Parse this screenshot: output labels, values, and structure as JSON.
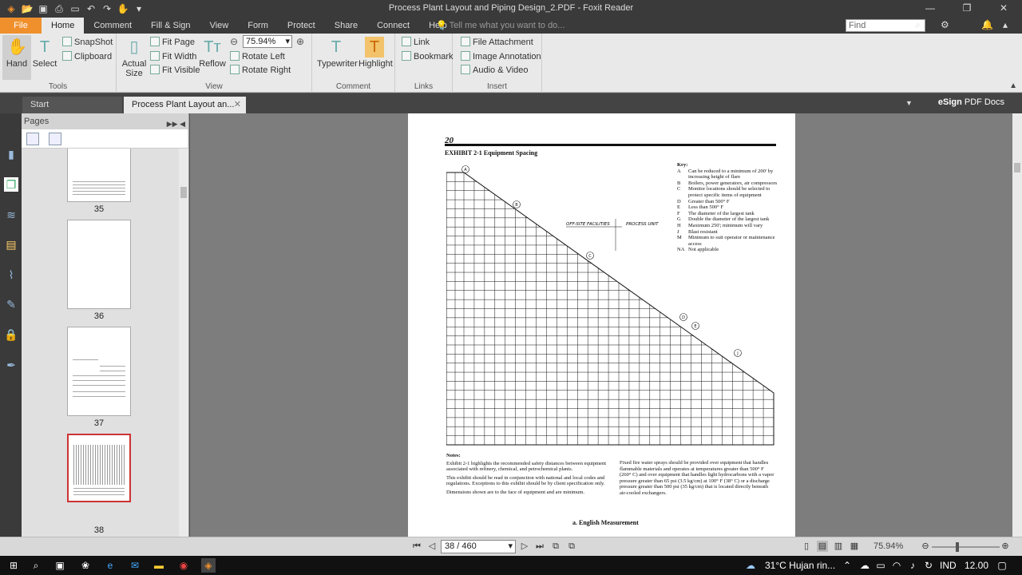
{
  "window": {
    "title": "Process Plant Layout and Piping Design_2.PDF - Foxit Reader",
    "controls": [
      "—",
      "❐",
      "✕"
    ]
  },
  "menu": {
    "file": "File",
    "tabs": [
      "Home",
      "Comment",
      "Fill & Sign",
      "View",
      "Form",
      "Protect",
      "Share",
      "Connect",
      "Help"
    ],
    "active_tab": "Home",
    "tell_me_placeholder": "Tell me what you want to do...",
    "find_placeholder": "Find"
  },
  "ribbon": {
    "tools": {
      "label": "Tools",
      "hand": "Hand",
      "select": "Select",
      "snapshot": "SnapShot",
      "clipboard": "Clipboard"
    },
    "view": {
      "label": "View",
      "actual_size": "Actual Size",
      "fit_page": "Fit Page",
      "fit_width": "Fit Width",
      "fit_visible": "Fit Visible",
      "reflow": "Reflow",
      "zoom_value": "75.94%",
      "rotate_left": "Rotate Left",
      "rotate_right": "Rotate Right"
    },
    "comment": {
      "label": "Comment",
      "typewriter": "Typewriter",
      "highlight": "Highlight"
    },
    "links": {
      "label": "Links",
      "link": "Link",
      "bookmark": "Bookmark"
    },
    "insert": {
      "label": "Insert",
      "file_attachment": "File Attachment",
      "image_annotation": "Image Annotation",
      "audio_video": "Audio & Video"
    }
  },
  "doc_tabs": {
    "start": "Start",
    "current": "Process Plant Layout an..."
  },
  "esign": {
    "bold": "eSign",
    "rest": " PDF Docs"
  },
  "pages_panel": {
    "title": "Pages",
    "thumbnails": [
      {
        "number": "35"
      },
      {
        "number": "36"
      },
      {
        "number": "37"
      },
      {
        "number": "38"
      }
    ]
  },
  "document": {
    "page_number": "20",
    "exhibit": "EXHIBIT 2-1    Equipment Spacing",
    "handwritten_1": "OFF-SITE FACILITIES",
    "handwritten_2": "PROCESS UNIT",
    "key_title": "Key:",
    "key": [
      {
        "k": "A",
        "v": "Can be reduced to a minimum of 200' by increasing height of flare"
      },
      {
        "k": "B",
        "v": "Boilers, power generators, air compressors"
      },
      {
        "k": "C",
        "v": "Monitor locations should be selected to protect specific items of equipment"
      },
      {
        "k": "D",
        "v": "Greater than 500° F"
      },
      {
        "k": "E",
        "v": "Less than 500° F"
      },
      {
        "k": "F",
        "v": "The diameter of the largest tank"
      },
      {
        "k": "G",
        "v": "Double the diameter of the largest tank"
      },
      {
        "k": "H",
        "v": "Maximum 250'; minimum will vary"
      },
      {
        "k": "J",
        "v": "Blast resistant"
      },
      {
        "k": "M",
        "v": "Minimum to suit operator or maintenance access"
      },
      {
        "k": "NA",
        "v": "Not applicable"
      }
    ],
    "notes_title": "Notes:",
    "notes": [
      "Exhibit 2-1 highlights the recommended safety distances between equipment associated with refinery, chemical, and petrochemical plants.",
      "This exhibit should be read in conjunction with national and local codes and regulations. Exceptions to this exhibit should be by client specification only.",
      "Dimensions shown are to the face of equipment and are minimum."
    ],
    "notes_right": "Fixed fire water sprays should be provided over equipment that handles flammable materials and operates at temperatures greater than 500° F (260° C) and over equipment that handles light hydrocarbons with a vapor pressure greater than 65 psi (3.5 kg/cm) at 100° F (38° C) or a discharge pressure greater than 500 psi (35 kg/cm) that is located directly beneath air-cooled exchangers.",
    "caption": "a. English Measurement"
  },
  "status": {
    "page_box": "38 / 460",
    "zoom": "75.94%"
  },
  "taskbar": {
    "weather": "31°C  Hujan rin...",
    "lang": "IND",
    "time": "12.00"
  }
}
